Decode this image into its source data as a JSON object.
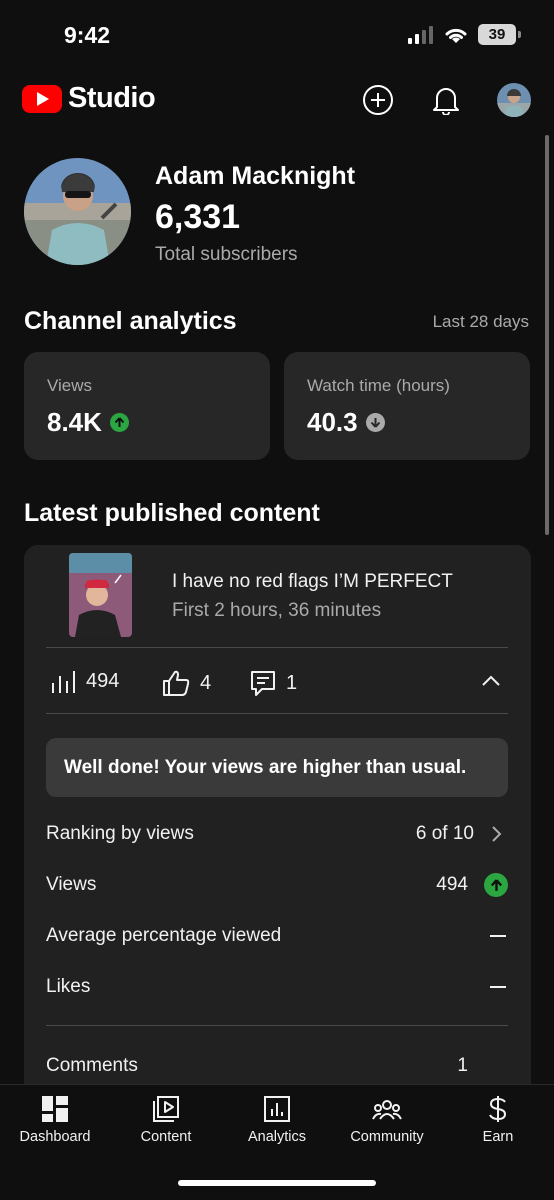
{
  "status_bar": {
    "time": "9:42",
    "battery": "39"
  },
  "header": {
    "logo_text": "Studio"
  },
  "channel": {
    "name": "Adam Macknight",
    "subscribers": "6,331",
    "subscribers_label": "Total subscribers"
  },
  "analytics": {
    "title": "Channel analytics",
    "range": "Last 28 days",
    "cards": [
      {
        "label": "Views",
        "value": "8.4K",
        "trend": "up"
      },
      {
        "label": "Watch time (hours)",
        "value": "40.3",
        "trend": "down"
      }
    ]
  },
  "latest": {
    "title": "Latest published content",
    "video": {
      "title": "I have no red flags I’M PERFECT",
      "subtitle": "First 2 hours, 36 minutes",
      "views": "494",
      "likes": "4",
      "comments": "1"
    },
    "banner": "Well done! Your views are higher than usual.",
    "rows": [
      {
        "label": "Ranking by views",
        "value": "6 of 10"
      },
      {
        "label": "Views",
        "value": "494"
      },
      {
        "label": "Average percentage viewed"
      },
      {
        "label": "Likes"
      },
      {
        "label": "Comments",
        "value": "1"
      }
    ]
  },
  "nav": {
    "items": [
      {
        "label": "Dashboard",
        "icon": "dashboard-icon"
      },
      {
        "label": "Content",
        "icon": "content-icon"
      },
      {
        "label": "Analytics",
        "icon": "analytics-icon"
      },
      {
        "label": "Community",
        "icon": "community-icon"
      },
      {
        "label": "Earn",
        "icon": "earn-icon"
      }
    ]
  },
  "colors": {
    "accent_red": "#ff0000",
    "trend_up": "#2ba640",
    "trend_down": "#aaaaaa",
    "card_bg": "#272727"
  }
}
